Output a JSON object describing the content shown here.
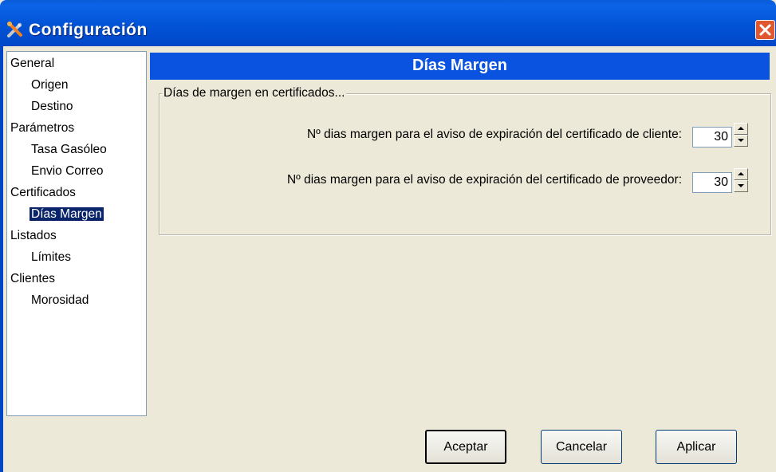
{
  "window": {
    "title": "Configuración",
    "close_label": "Cerrar"
  },
  "tree": {
    "items": [
      {
        "label": "General",
        "level": 0
      },
      {
        "label": "Origen",
        "level": 1
      },
      {
        "label": "Destino",
        "level": 1
      },
      {
        "label": "Parámetros",
        "level": 0
      },
      {
        "label": "Tasa Gasóleo",
        "level": 1
      },
      {
        "label": "Envio Correo",
        "level": 1
      },
      {
        "label": "Certificados",
        "level": 0
      },
      {
        "label": "Días Margen",
        "level": 1,
        "selected": true
      },
      {
        "label": "Listados",
        "level": 0
      },
      {
        "label": "Límites",
        "level": 1
      },
      {
        "label": "Clientes",
        "level": 0
      },
      {
        "label": "Morosidad",
        "level": 1
      }
    ]
  },
  "panel": {
    "header": "Días Margen",
    "group_title": "Días de margen en certificados...",
    "fields": [
      {
        "label": "Nº dias margen para el aviso de expiración del certificado de cliente:",
        "value": "30"
      },
      {
        "label": "Nº dias margen para el aviso de expiración del certificado de proveedor:",
        "value": "30"
      }
    ]
  },
  "buttons": {
    "accept": "Aceptar",
    "cancel": "Cancelar",
    "apply": "Aplicar"
  },
  "colors": {
    "titlebar": "#0253d6",
    "header_bar": "#0a53e1",
    "selection": "#0a246a",
    "close": "#e0582f",
    "window_bg": "#ece9d8"
  }
}
